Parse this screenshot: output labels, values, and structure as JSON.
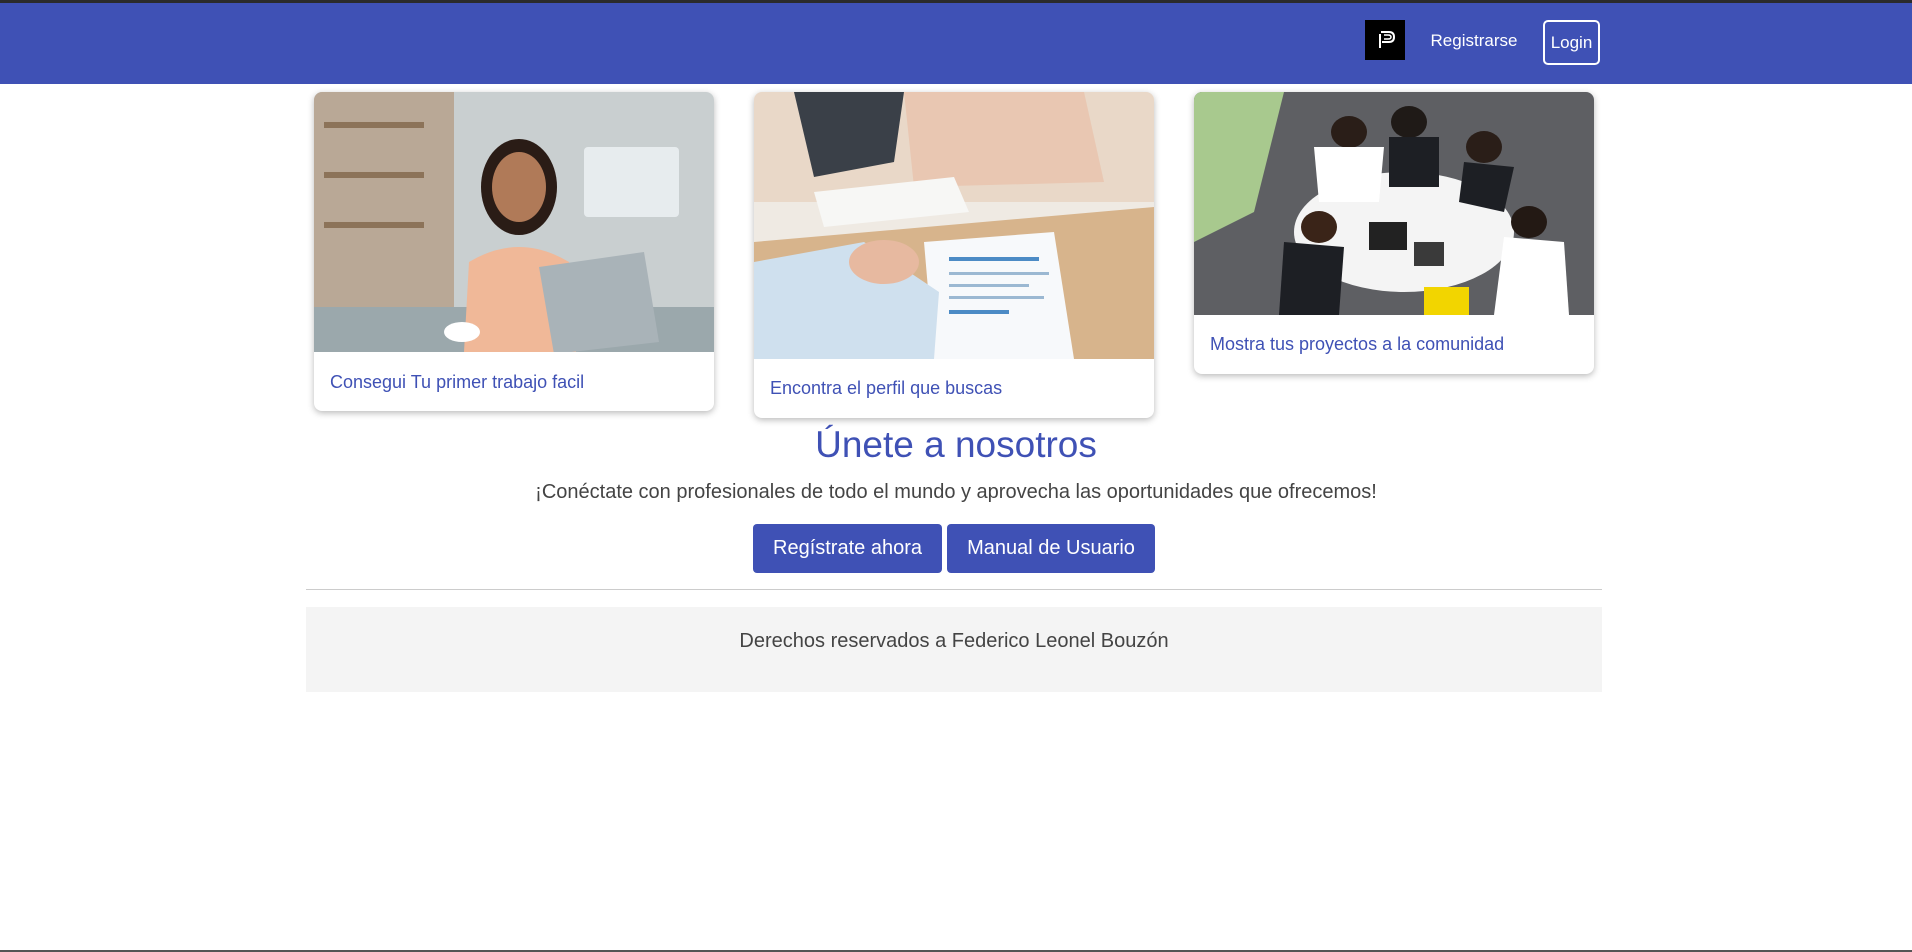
{
  "navbar": {
    "logo_icon": "p-logo-icon",
    "register_link": "Registrarse",
    "login_button": "Login",
    "color": "#3f51b5"
  },
  "cards": [
    {
      "caption": "Consegui Tu primer trabajo facil",
      "image": "woman-with-laptop-photo"
    },
    {
      "caption": "Encontra el perfil que buscas",
      "image": "job-interview-resume-photo"
    },
    {
      "caption": "Mostra tus proyectos a la comunidad",
      "image": "business-team-meeting-photo"
    }
  ],
  "join": {
    "title": "Únete a nosotros",
    "subtitle": "¡Conéctate con profesionales de todo el mundo y aprovecha las oportunidades que ofrecemos!",
    "register_button": "Regístrate ahora",
    "manual_button": "Manual de Usuario"
  },
  "footer": {
    "text": "Derechos reservados a Federico Leonel Bouzón"
  }
}
